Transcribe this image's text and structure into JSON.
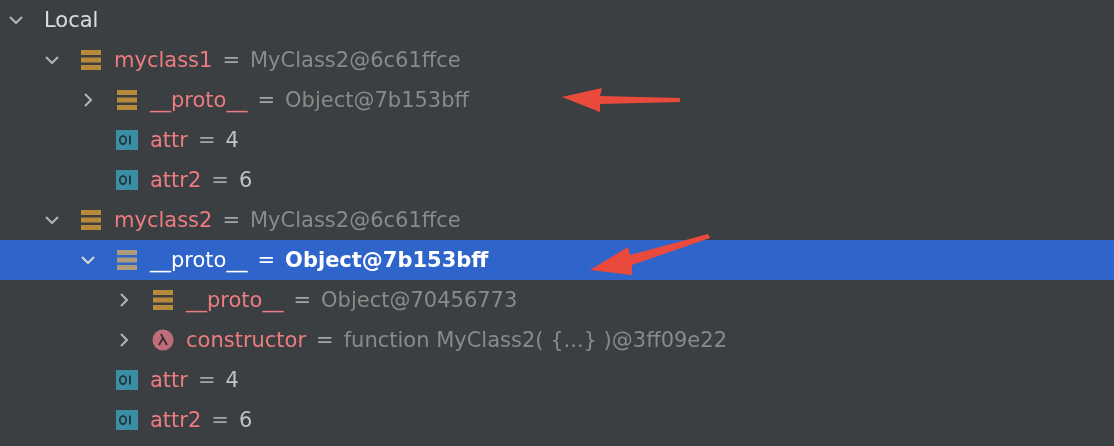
{
  "variables": [
    {
      "kind": "group",
      "name": "Local",
      "expanded": true,
      "selected": false,
      "children": [
        {
          "kind": "object",
          "name": "myclass1",
          "value": "MyClass2@6c61ffce",
          "expanded": true,
          "selected": false,
          "children": [
            {
              "kind": "object",
              "name": "__proto__",
              "value": "Object@7b153bff",
              "expanded": false,
              "selected": false
            },
            {
              "kind": "primitive",
              "name": "attr",
              "value": "4",
              "selected": false
            },
            {
              "kind": "primitive",
              "name": "attr2",
              "value": "6",
              "selected": false
            }
          ]
        },
        {
          "kind": "object",
          "name": "myclass2",
          "value": "MyClass2@6c61ffce",
          "expanded": true,
          "selected": false,
          "children": [
            {
              "kind": "object",
              "name": "__proto__",
              "value": "Object@7b153bff",
              "expanded": true,
              "selected": true,
              "children": [
                {
                  "kind": "object",
                  "name": "__proto__",
                  "value": "Object@70456773",
                  "expanded": false,
                  "selected": false
                },
                {
                  "kind": "function",
                  "name": "constructor",
                  "value": "function MyClass2( {...} )@3ff09e22",
                  "expanded": false,
                  "selected": false
                }
              ]
            },
            {
              "kind": "primitive",
              "name": "attr",
              "value": "4",
              "selected": false
            },
            {
              "kind": "primitive",
              "name": "attr2",
              "value": "6",
              "selected": false
            }
          ]
        }
      ]
    }
  ],
  "equals_sign": "="
}
